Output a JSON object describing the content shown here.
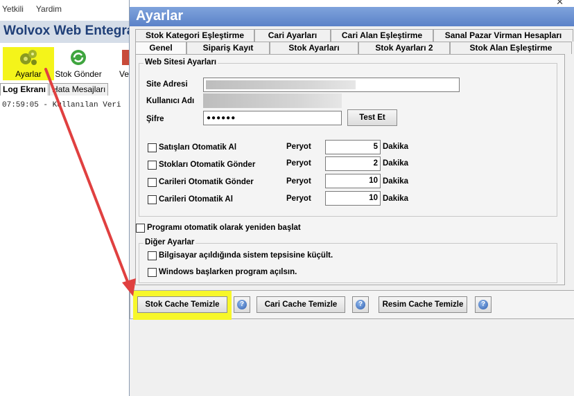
{
  "bg": {
    "menu": [
      "Yetkili",
      "Yardim"
    ],
    "app_title": "Wolvox Web Entegrasyonu",
    "toolbar": [
      {
        "label": "Ayarlar",
        "icon": "gears-icon"
      },
      {
        "label": "Stok Gönder",
        "icon": "refresh-icon"
      },
      {
        "label": "Ve",
        "icon": "document-icon"
      }
    ],
    "log_tabs": [
      "Log Ekranı",
      "Hata Mesajları"
    ],
    "log_line": "07:59:05 - Kullanılan Veri"
  },
  "window": {
    "title": "Ayarlar",
    "tabs_row1": [
      "Stok Kategori Eşleştirme",
      "Cari Ayarları",
      "Cari Alan Eşleştirme",
      "Sanal Pazar Virman Hesapları"
    ],
    "tabs_row2": [
      "Genel",
      "Sipariş Kayıt",
      "Stok Ayarları",
      "Stok Ayarları 2",
      "Stok Alan Eşleştirme"
    ],
    "site_group_title": "Web Sitesi Ayarları",
    "site_label": "Site Adresi",
    "user_label": "Kullanıcı Adı",
    "pass_label": "Şifre",
    "pass_value": "●●●●●●",
    "test_button": "Test Et",
    "auto": [
      {
        "label": "Satışları Otomatik Al",
        "peryot_label": "Peryot",
        "value": "5",
        "unit": "Dakika"
      },
      {
        "label": "Stokları Otomatik Gönder",
        "peryot_label": "Peryot",
        "value": "2",
        "unit": "Dakika"
      },
      {
        "label": "Carileri Otomatik Gönder",
        "peryot_label": "Peryot",
        "value": "10",
        "unit": "Dakika"
      },
      {
        "label": "Carileri Otomatik Al",
        "peryot_label": "Peryot",
        "value": "10",
        "unit": "Dakika"
      }
    ],
    "restart_label": "Programı otomatik olarak yeniden başlat",
    "other_group_title": "Diğer Ayarlar",
    "other_items": [
      "Bilgisayar açıldığında sistem tepsisine küçült.",
      "Windows başlarken program açılsın."
    ],
    "buttons": {
      "stok_cache": "Stok Cache Temizle",
      "cari_cache": "Cari Cache Temizle",
      "resim_cache": "Resim Cache Temizle",
      "help_glyph": "?"
    }
  },
  "colors": {
    "highlight": "#f4f41a",
    "arrow": "#e04040",
    "header": "#5b82c8"
  }
}
